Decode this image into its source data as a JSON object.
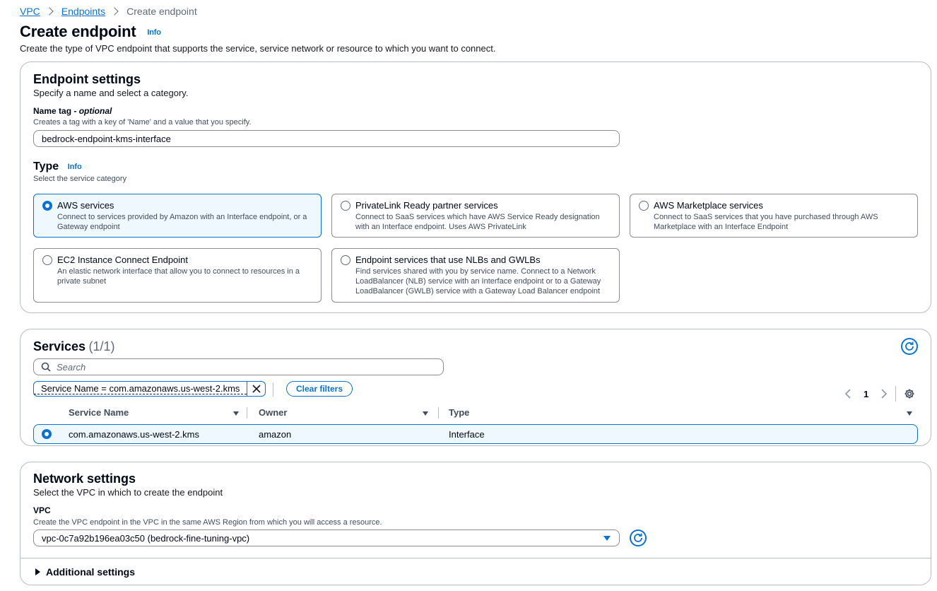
{
  "breadcrumb": {
    "vpc": "VPC",
    "endpoints": "Endpoints",
    "current": "Create endpoint"
  },
  "header": {
    "title": "Create endpoint",
    "info": "Info",
    "description": "Create the type of VPC endpoint that supports the service, service network or resource to which you want to connect."
  },
  "endpoint_settings": {
    "title": "Endpoint settings",
    "subtitle": "Specify a name and select a category.",
    "name_tag_label": "Name tag - ",
    "name_tag_optional": "optional",
    "name_tag_desc": "Creates a tag with a key of 'Name' and a value that you specify.",
    "name_tag_value": "bedrock-endpoint-kms-interface",
    "type_label": "Type",
    "type_info": "Info",
    "type_desc": "Select the service category",
    "options": [
      {
        "title": "AWS services",
        "desc": "Connect to services provided by Amazon with an Interface endpoint, or a Gateway endpoint",
        "selected": true
      },
      {
        "title": "PrivateLink Ready partner services",
        "desc": "Connect to SaaS services which have AWS Service Ready designation with an Interface endpoint. Uses AWS PrivateLink",
        "selected": false
      },
      {
        "title": "AWS Marketplace services",
        "desc": "Connect to SaaS services that you have purchased through AWS Marketplace with an Interface Endpoint",
        "selected": false
      },
      {
        "title": "EC2 Instance Connect Endpoint",
        "desc": "An elastic network interface that allow you to connect to resources in a private subnet",
        "selected": false
      },
      {
        "title": "Endpoint services that use NLBs and GWLBs",
        "desc": "Find services shared with you by service name. Connect to a Network LoadBalancer (NLB) service with an Interface endpoint or to a Gateway LoadBalancer (GWLB) service with a Gateway Load Balancer endpoint",
        "selected": false
      }
    ]
  },
  "services": {
    "title": "Services",
    "count": "(1/1)",
    "search_placeholder": "Search",
    "filter_token": "Service Name = com.amazonaws.us-west-2.kms",
    "clear_filters": "Clear filters",
    "page_number": "1",
    "columns": [
      "Service Name",
      "Owner",
      "Type"
    ],
    "rows": [
      {
        "service_name": "com.amazonaws.us-west-2.kms",
        "owner": "amazon",
        "type": "Interface",
        "selected": true
      }
    ]
  },
  "network_settings": {
    "title": "Network settings",
    "subtitle": "Select the VPC in which to create the endpoint",
    "vpc_label": "VPC",
    "vpc_desc": "Create the VPC endpoint in the VPC in the same AWS Region from which you will access a resource.",
    "vpc_value": "vpc-0c7a92b196ea03c50 (bedrock-fine-tuning-vpc)",
    "additional_settings": "Additional settings"
  },
  "colors": {
    "accent": "#0972d3",
    "text": "#000716",
    "border": "#b6bec9"
  }
}
